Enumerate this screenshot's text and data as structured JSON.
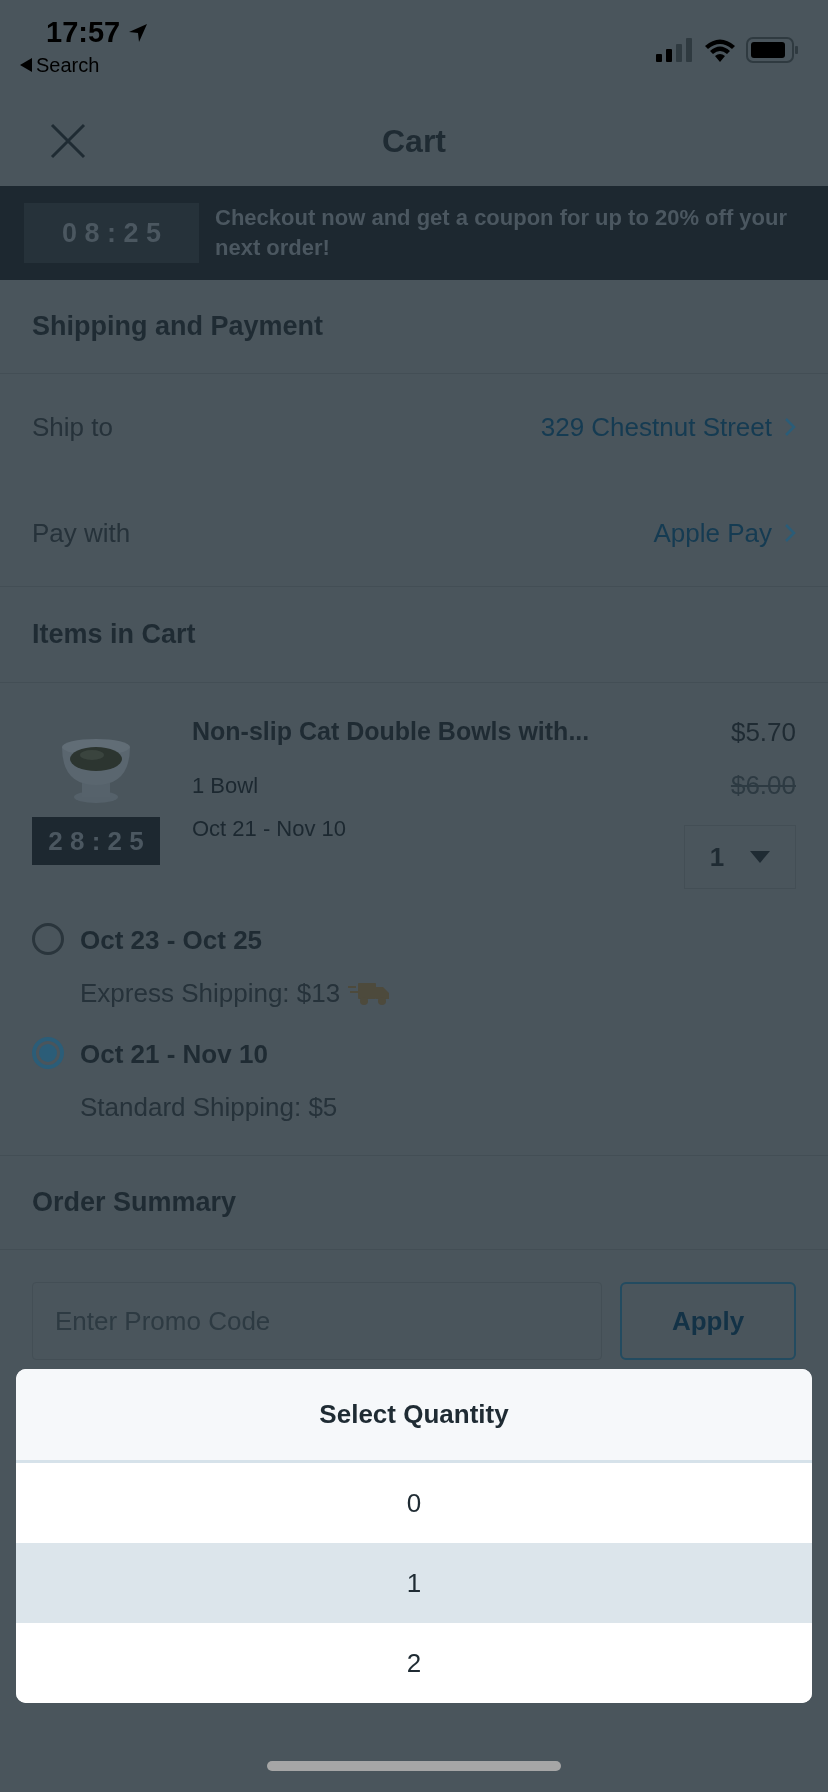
{
  "status_bar": {
    "time": "17:57",
    "back_label": "Search"
  },
  "nav": {
    "title": "Cart"
  },
  "banner": {
    "timer": "0 8 : 2 5",
    "message": "Checkout now and get a coupon for up to 20% off your next order!"
  },
  "shipping_payment": {
    "heading": "Shipping and Payment",
    "rows": [
      {
        "label": "Ship to",
        "value": "329 Chestnut Street"
      },
      {
        "label": "Pay with",
        "value": "Apple Pay"
      }
    ]
  },
  "items": {
    "heading": "Items in Cart",
    "products": [
      {
        "title": "Non-slip Cat Double Bowls with...",
        "variant": "1 Bowl",
        "dates": "Oct 21 - Nov 10",
        "price": "$5.70",
        "original_price": "$6.00",
        "timer": "2 8 : 2 5",
        "quantity": "1"
      }
    ],
    "shipping_options": [
      {
        "dates": "Oct 23 - Oct 25",
        "description": "Express Shipping: $13",
        "express": true,
        "selected": false
      },
      {
        "dates": "Oct 21 - Nov 10",
        "description": "Standard Shipping: $5",
        "express": false,
        "selected": true
      }
    ]
  },
  "order_summary": {
    "heading": "Order Summary",
    "promo_placeholder": "Enter Promo Code",
    "apply_label": "Apply"
  },
  "quantity_sheet": {
    "title": "Select Quantity",
    "options": [
      {
        "label": "0",
        "selected": false
      },
      {
        "label": "1",
        "selected": true
      },
      {
        "label": "2",
        "selected": false
      }
    ]
  }
}
